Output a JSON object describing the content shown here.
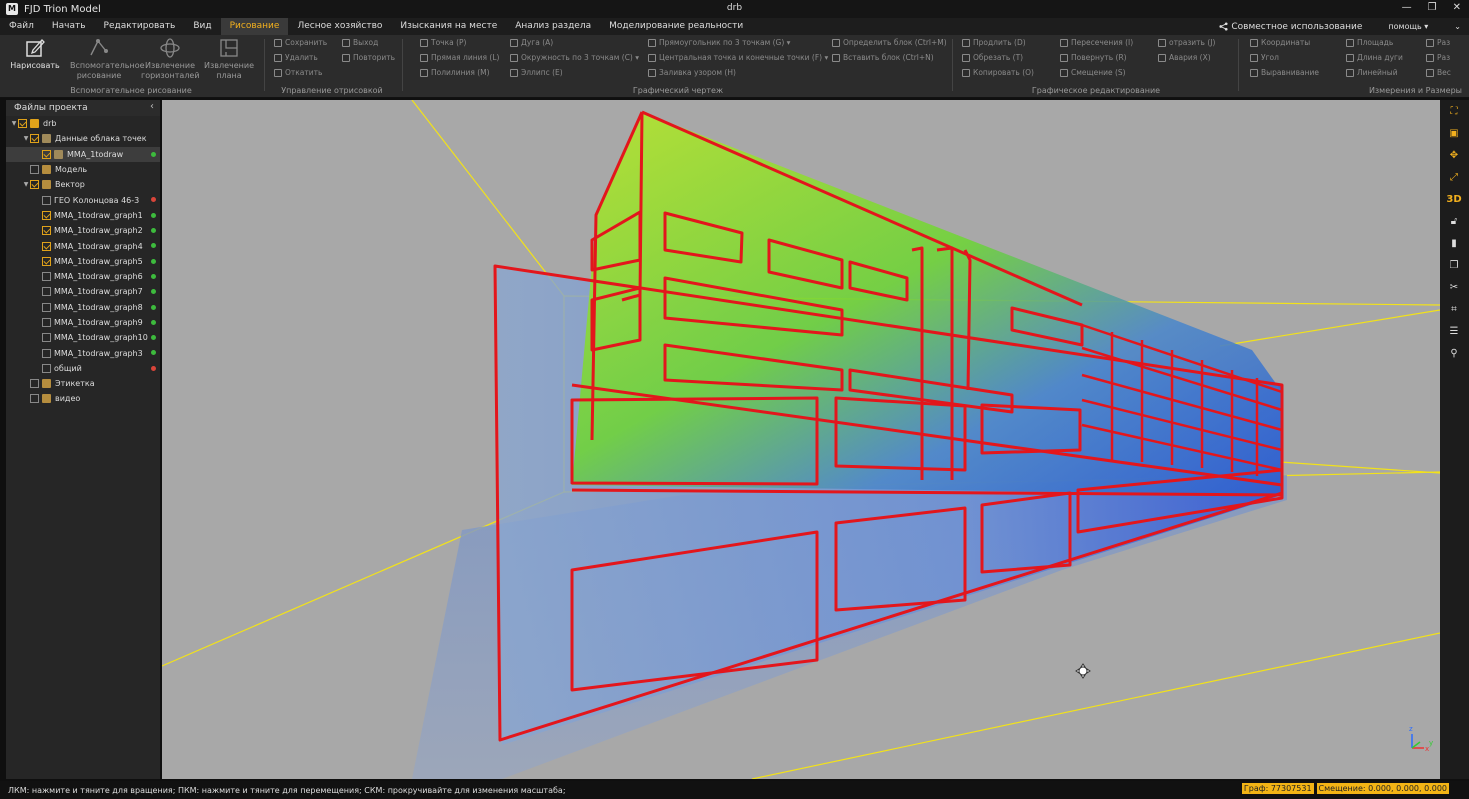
{
  "titlebar": {
    "app": "FJD Trion Model",
    "document": "drb",
    "min": "—",
    "restore": "❐",
    "close": "✕",
    "logo": "M"
  },
  "menu": {
    "items": [
      "Файл",
      "Начать",
      "Редактировать",
      "Вид",
      "Рисование",
      "Лесное хозяйство",
      "Изыскания на месте",
      "Анализ раздела",
      "Моделирование реальности"
    ],
    "active_index": 4,
    "share": "Совместное использование",
    "help": "помощь ▾",
    "more": "⌄"
  },
  "ribbon": {
    "aux_group": {
      "title": "Вспомогательное рисование",
      "buttons": [
        {
          "label": "Нарисовать",
          "enabled": true
        },
        {
          "label": "Вспомогательное рисование",
          "enabled": false
        },
        {
          "label": "Извлечение горизонталей",
          "enabled": false
        },
        {
          "label": "Извлечение плана",
          "enabled": false
        }
      ]
    },
    "manage_group": {
      "title": "Управление отрисовкой",
      "items": [
        "Сохранить",
        "Выход",
        "Удалить",
        "Повторить",
        "Откатить"
      ]
    },
    "graphic_group": {
      "title": "Графический чертеж",
      "items": [
        "Точка (P)",
        "Дуга (A)",
        "Прямоугольник по 3 точкам (G) ▾",
        "Определить блок (Ctrl+M)",
        "Прямая линия (L)",
        "Окружность по 3 точкам (C) ▾",
        "Центральная точка и конечные точки (F) ▾",
        "Вставить блок (Ctrl+N)",
        "Полилиния (M)",
        "Эллипс (E)",
        "Заливка узором (H)"
      ]
    },
    "edit_group": {
      "title": "Графическое редактирование",
      "items": [
        "Продлить (D)",
        "Пересечения (I)",
        "отразить (J)",
        "Обрезать (T)",
        "Повернуть (R)",
        "Авария (X)",
        "Копировать (O)",
        "Смещение (S)"
      ]
    },
    "measure_group": {
      "title": "Измерения и Размеры",
      "items": [
        "Координаты",
        "Площадь",
        "Раз",
        "Угол",
        "Длина дуги",
        "Раз",
        "Выравнивание",
        "Линейный",
        "Вес"
      ]
    }
  },
  "sidebar": {
    "title": "Файлы проекта",
    "collapse": "‹",
    "tree": [
      {
        "label": "drb",
        "level": 0,
        "expand": true,
        "checked": true,
        "icon": "folder-icon",
        "dot": ""
      },
      {
        "label": "Данные облака точек",
        "level": 1,
        "expand": true,
        "checked": true,
        "icon": "pointcloud-icon",
        "dot": ""
      },
      {
        "label": "MMA_1todraw",
        "level": 2,
        "expand": false,
        "checked": true,
        "icon": "pointcloud-icon",
        "dot": "#3dbb3d",
        "selected": true
      },
      {
        "label": "Модель",
        "level": 1,
        "expand": false,
        "checked": false,
        "icon": "model-icon",
        "dot": ""
      },
      {
        "label": "Вектор",
        "level": 1,
        "expand": true,
        "checked": true,
        "icon": "vector-icon",
        "dot": ""
      },
      {
        "label": "ГЕО Колонцова 46-3",
        "level": 2,
        "expand": false,
        "checked": false,
        "icon": "",
        "dot": "#d9453a"
      },
      {
        "label": "MMA_1todraw_graph1",
        "level": 2,
        "expand": false,
        "checked": true,
        "icon": "",
        "dot": "#3dbb3d"
      },
      {
        "label": "MMA_1todraw_graph2",
        "level": 2,
        "expand": false,
        "checked": true,
        "icon": "",
        "dot": "#3dbb3d"
      },
      {
        "label": "MMA_1todraw_graph4",
        "level": 2,
        "expand": false,
        "checked": true,
        "icon": "",
        "dot": "#3dbb3d"
      },
      {
        "label": "MMA_1todraw_graph5",
        "level": 2,
        "expand": false,
        "checked": true,
        "icon": "",
        "dot": "#3dbb3d"
      },
      {
        "label": "MMA_1todraw_graph6",
        "level": 2,
        "expand": false,
        "checked": false,
        "icon": "",
        "dot": "#3dbb3d"
      },
      {
        "label": "MMA_1todraw_graph7",
        "level": 2,
        "expand": false,
        "checked": false,
        "icon": "",
        "dot": "#3dbb3d"
      },
      {
        "label": "MMA_1todraw_graph8",
        "level": 2,
        "expand": false,
        "checked": false,
        "icon": "",
        "dot": "#3dbb3d"
      },
      {
        "label": "MMA_1todraw_graph9",
        "level": 2,
        "expand": false,
        "checked": false,
        "icon": "",
        "dot": "#3dbb3d"
      },
      {
        "label": "MMA_1todraw_graph10",
        "level": 2,
        "expand": false,
        "checked": false,
        "icon": "",
        "dot": "#3dbb3d"
      },
      {
        "label": "MMA_1todraw_graph3",
        "level": 2,
        "expand": false,
        "checked": false,
        "icon": "",
        "dot": "#3dbb3d"
      },
      {
        "label": "общий",
        "level": 2,
        "expand": false,
        "checked": false,
        "icon": "",
        "dot": "#d9453a"
      },
      {
        "label": "Этикетка",
        "level": 1,
        "expand": false,
        "checked": false,
        "icon": "label-icon",
        "dot": ""
      },
      {
        "label": "видео",
        "level": 1,
        "expand": false,
        "checked": false,
        "icon": "video-icon",
        "dot": ""
      }
    ]
  },
  "viewport": {
    "background": "#a8a8a8",
    "outline_color": "#e3161c",
    "guide_color": "#f2e21a",
    "axis_z": "z",
    "axis_x": "x",
    "axis_y": "y"
  },
  "right_tools": [
    "fit-view-icon",
    "view-cube-icon",
    "orbit-icon",
    "transform-icon",
    "3D",
    "unlock-icon",
    "color-bar-icon",
    "layers-icon",
    "erase-icon",
    "crop-icon",
    "list-icon",
    "pin-icon"
  ],
  "status": {
    "hint": "ЛКМ: нажмите и тяните для вращения; ПКМ: нажмите и тяните для перемещения; СКМ: прокручивайте для изменения масштаба;",
    "graph": "Граф: 77307531",
    "offset": "Смещение: 0.000, 0.000, 0.000"
  },
  "colors": {
    "accent": "#f2b01e",
    "tree_folder": "#e0a21a"
  }
}
